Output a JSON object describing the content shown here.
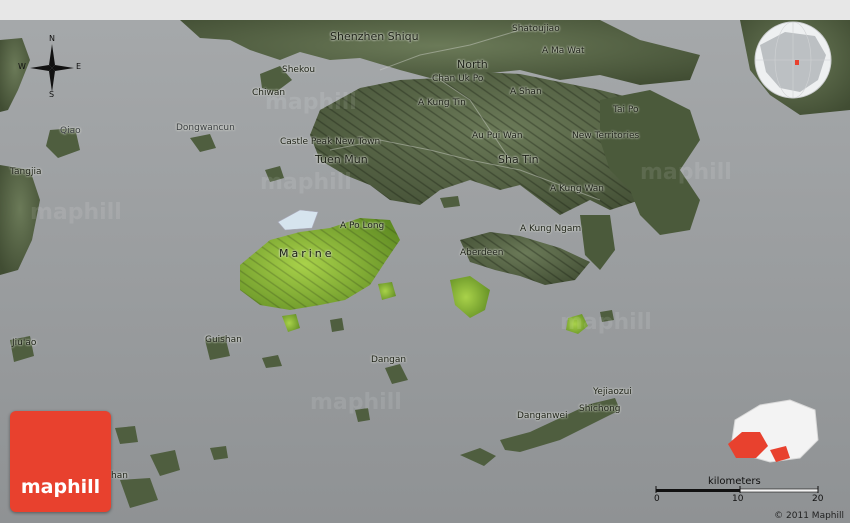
{
  "map": {
    "labels": [
      {
        "id": "shenzhen-shiqu",
        "text": "Shenzhen Shiqu",
        "size": "big"
      },
      {
        "id": "shatoujiao",
        "text": "Shatoujiao"
      },
      {
        "id": "a-ma-wat",
        "text": "A Ma Wat"
      },
      {
        "id": "north",
        "text": "North",
        "size": "big"
      },
      {
        "id": "chan-uk-po",
        "text": "Chan Uk Po"
      },
      {
        "id": "shekou",
        "text": "Shekou"
      },
      {
        "id": "chiwan",
        "text": "Chiwan"
      },
      {
        "id": "a-shan",
        "text": "A Shan"
      },
      {
        "id": "a-kung-tin",
        "text": "A Kung Tin"
      },
      {
        "id": "tai-po",
        "text": "Tai Po"
      },
      {
        "id": "qiao",
        "text": "Qiao"
      },
      {
        "id": "dongwancun",
        "text": "Dongwancun"
      },
      {
        "id": "castle-peak-new-town",
        "text": "Castle Peak New Town"
      },
      {
        "id": "au-pui-wan",
        "text": "Au Pui Wan"
      },
      {
        "id": "new-territories",
        "text": "New Territories"
      },
      {
        "id": "tuen-mun",
        "text": "Tuen Mun",
        "size": "big"
      },
      {
        "id": "sha-tin",
        "text": "Sha Tin",
        "size": "big"
      },
      {
        "id": "tangjia",
        "text": "Tangjia"
      },
      {
        "id": "a-kung-wan",
        "text": "A Kung Wan"
      },
      {
        "id": "a-po-long",
        "text": "A Po Long"
      },
      {
        "id": "a-kung-ngam",
        "text": "A Kung Ngam"
      },
      {
        "id": "marine",
        "text": "Marine",
        "size": "marine"
      },
      {
        "id": "aberdeen",
        "text": "Aberdeen"
      },
      {
        "id": "jiuao",
        "text": "Jiu'ao"
      },
      {
        "id": "guishan",
        "text": "Guishan"
      },
      {
        "id": "dangan",
        "text": "Dangan"
      },
      {
        "id": "yejiaozui",
        "text": "Yejiaozui"
      },
      {
        "id": "shichong",
        "text": "Shichong"
      },
      {
        "id": "danganwei",
        "text": "Danganwei"
      },
      {
        "id": "han",
        "text": "han"
      }
    ],
    "watermark_text": "maphill"
  },
  "compass": {
    "n": "N",
    "s": "S",
    "e": "E",
    "w": "W"
  },
  "logo": {
    "text": "maphill",
    "color": "#e8412e"
  },
  "scale": {
    "title": "kilometers",
    "ticks": [
      "0",
      "10",
      "20"
    ]
  },
  "copyright": "© 2011 Maphill",
  "colors": {
    "sea": "#9a9d9f",
    "land": "#5b6a4a",
    "highlight_land": "#8fc23a",
    "locator_red": "#e8412e"
  }
}
